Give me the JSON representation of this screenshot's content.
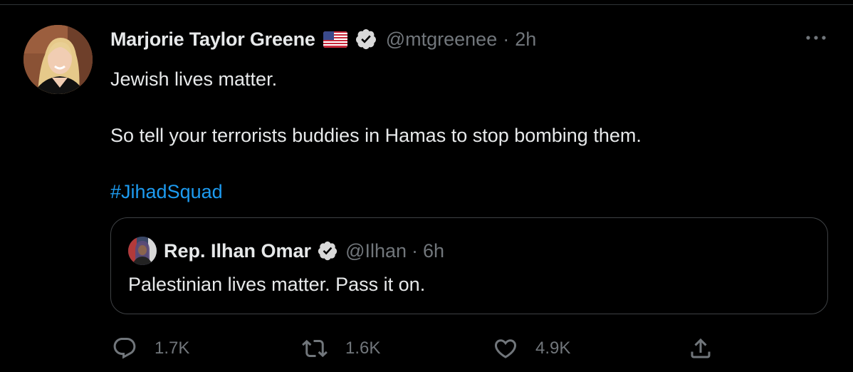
{
  "tweet": {
    "author_name": "Marjorie Taylor Greene",
    "author_handle": "@mtgreenee",
    "separator": "·",
    "time": "2h",
    "lines": [
      "Jewish lives matter.",
      "So tell your terrorists buddies in Hamas to stop bombing them.",
      "#JihadSquad"
    ],
    "hashtag_color": "#1d9bf0"
  },
  "quoted": {
    "author_name": "Rep. Ilhan Omar",
    "author_handle": "@Ilhan",
    "separator": "·",
    "time": "6h",
    "text": "Palestinian lives matter. Pass it on."
  },
  "actions": {
    "reply_count": "1.7K",
    "retweet_count": "1.6K",
    "like_count": "4.9K"
  },
  "icons": {
    "flag": "us-flag-icon",
    "verified": "verified-badge-icon",
    "more": "more-options-icon",
    "reply": "reply-icon",
    "retweet": "retweet-icon",
    "like": "heart-icon",
    "share": "share-icon"
  },
  "colors": {
    "background": "#000000",
    "text": "#e7e9ea",
    "secondary": "#71767b",
    "accent": "#1d9bf0",
    "border": "#3e4144"
  }
}
